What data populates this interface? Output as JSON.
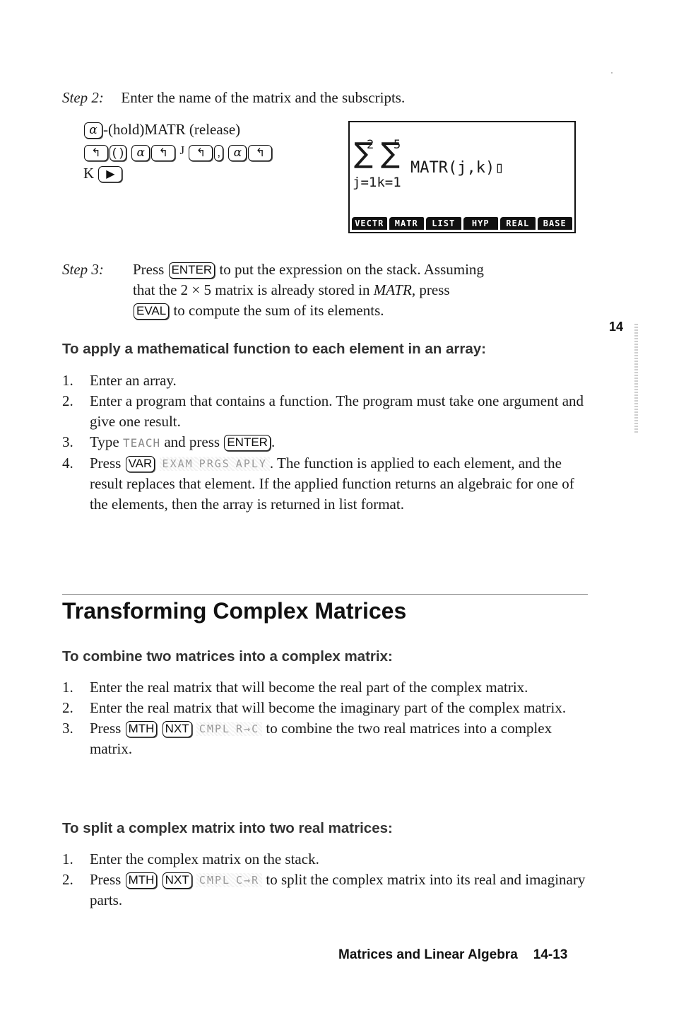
{
  "step2": {
    "label": "Step 2:",
    "text": "Enter the name of the matrix and the subscripts.",
    "keys_line1": {
      "alpha_key": "α",
      "text": "-(hold)MATR (release)"
    },
    "keys_line2": {
      "k1": "↰",
      "k2": "( )",
      "k3": "α",
      "k4": "↰",
      "letter1": "J",
      "k5": "↰",
      "k6": ",",
      "k7": "α",
      "k8": "↰"
    },
    "keys_line3": {
      "letter": "K",
      "k1": "▶"
    }
  },
  "calculator_screen": {
    "upper_limit_1": "2",
    "upper_limit_2": "5",
    "sigma": "∑",
    "expression": "MATR(j,k)▯",
    "lower_limits": "j=1k=1",
    "menu": [
      "VECTR",
      "MATR",
      "LIST",
      "HYP",
      "REAL",
      "BASE"
    ]
  },
  "step3": {
    "label": "Step 3:",
    "press": "Press",
    "enter_key": "ENTER",
    "text1": "to put the expression on the stack. Assuming",
    "text2a": "that the 2 × 5 matrix is already stored in",
    "matr_italic": "MATR",
    "text2b": ", press",
    "eval_key": "EVAL",
    "text3": "to compute the sum of its elements."
  },
  "chapter_tab": "14",
  "section_apply": {
    "heading": "To apply a mathematical function to each element in an array:",
    "items": [
      {
        "num": "1.",
        "text": "Enter an array."
      },
      {
        "num": "2.",
        "text": "Enter a program that contains a function. The program must take one argument and give one result."
      },
      {
        "num": "3.",
        "type": "Type",
        "mono": "TEACH",
        "mid": "and press",
        "key": "ENTER",
        "end": "."
      },
      {
        "num": "4.",
        "press": "Press",
        "key": "VAR",
        "softkeys": [
          "EXAM",
          "PRGS",
          "APLY"
        ],
        "text": ". The function is applied to each element, and the result replaces that element. If the applied function returns an algebraic for one of the elements, then the array is returned in list format."
      }
    ]
  },
  "section_title": "Transforming Complex Matrices",
  "section_combine": {
    "heading": "To combine two matrices into a complex matrix:",
    "items": [
      {
        "num": "1.",
        "text": "Enter the real matrix that will become the real part of the complex matrix."
      },
      {
        "num": "2.",
        "text": "Enter the real matrix that will become the imaginary part of the complex matrix."
      },
      {
        "num": "3.",
        "press": "Press",
        "keys": [
          "MTH",
          "NXT"
        ],
        "softkeys": [
          "CMPL",
          "R→C"
        ],
        "text": "to combine the two real matrices into a complex matrix."
      }
    ]
  },
  "section_split": {
    "heading": "To split a complex matrix into two real matrices:",
    "items": [
      {
        "num": "1.",
        "text": "Enter the complex matrix on the stack."
      },
      {
        "num": "2.",
        "press": "Press",
        "keys": [
          "MTH",
          "NXT"
        ],
        "softkeys": [
          "CMPL",
          "C→R"
        ],
        "text": "to split the complex matrix into its real and imaginary parts."
      }
    ]
  },
  "footer": {
    "title": "Matrices and Linear Algebra",
    "page": "14-13"
  }
}
